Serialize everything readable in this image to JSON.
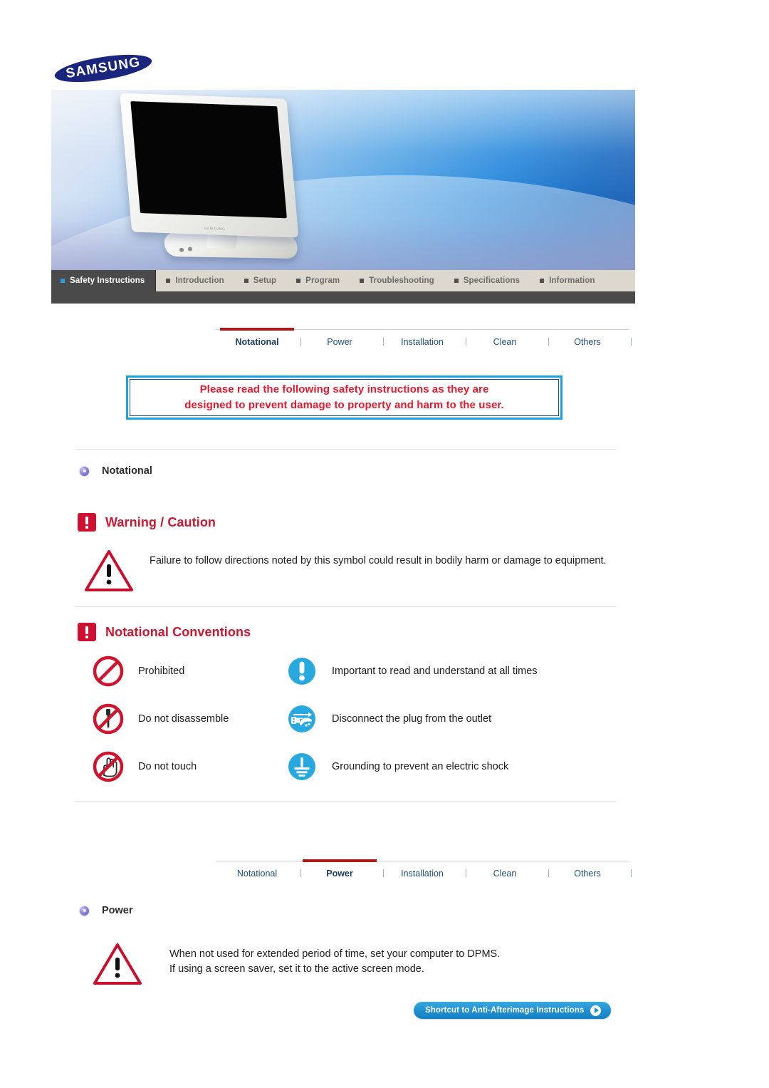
{
  "brand": {
    "logo_text": "SAMSUNG"
  },
  "hero": {
    "product": "lcd-monitor"
  },
  "main_nav": {
    "items": [
      {
        "label": "Safety Instructions",
        "active": true
      },
      {
        "label": "Introduction",
        "active": false
      },
      {
        "label": "Setup",
        "active": false
      },
      {
        "label": "Program",
        "active": false
      },
      {
        "label": "Troubleshooting",
        "active": false
      },
      {
        "label": "Specifications",
        "active": false
      },
      {
        "label": "Information",
        "active": false
      }
    ]
  },
  "sub_nav_top": {
    "items": [
      {
        "label": "Notational",
        "active": true
      },
      {
        "label": "Power",
        "active": false
      },
      {
        "label": "Installation",
        "active": false
      },
      {
        "label": "Clean",
        "active": false
      },
      {
        "label": "Others",
        "active": false
      }
    ]
  },
  "sub_nav_bottom": {
    "items": [
      {
        "label": "Notational",
        "active": false
      },
      {
        "label": "Power",
        "active": true
      },
      {
        "label": "Installation",
        "active": false
      },
      {
        "label": "Clean",
        "active": false
      },
      {
        "label": "Others",
        "active": false
      }
    ]
  },
  "notice": {
    "line1": "Please read the following safety instructions as they are",
    "line2": "designed to prevent damage to property and harm to the user."
  },
  "notational_section": {
    "heading": "Notational",
    "warning_heading": "Warning / Caution",
    "warning_text": "Failure to follow directions noted by this symbol could result in bodily harm or damage to equipment.",
    "conventions_heading": "Notational Conventions",
    "conventions": [
      {
        "icon": "prohibited-icon",
        "label": "Prohibited"
      },
      {
        "icon": "important-icon",
        "label": "Important to read and understand at all times"
      },
      {
        "icon": "do-not-disassemble-icon",
        "label": "Do not disassemble"
      },
      {
        "icon": "disconnect-plug-icon",
        "label": "Disconnect the plug from the outlet"
      },
      {
        "icon": "do-not-touch-icon",
        "label": "Do not touch"
      },
      {
        "icon": "grounding-icon",
        "label": "Grounding to prevent an electric shock"
      }
    ]
  },
  "power_section": {
    "heading": "Power",
    "line1": "When not used for extended period of time, set your computer to DPMS.",
    "line2": "If using a screen saver, set it to the active screen mode.",
    "shortcut_label": "Shortcut to Anti-Afterimage Instructions"
  },
  "colors": {
    "accent_red": "#cf1030",
    "accent_blue": "#1f8fd0",
    "nav_active_bg": "#4a4a4a",
    "nav_bg": "#ddd8cd",
    "notice_border": "#19a3e0",
    "notice_text": "#e8172c",
    "tab_underline": "#a91b1b",
    "icon_blue": "#27a9e0",
    "icon_red": "#d1142e"
  }
}
